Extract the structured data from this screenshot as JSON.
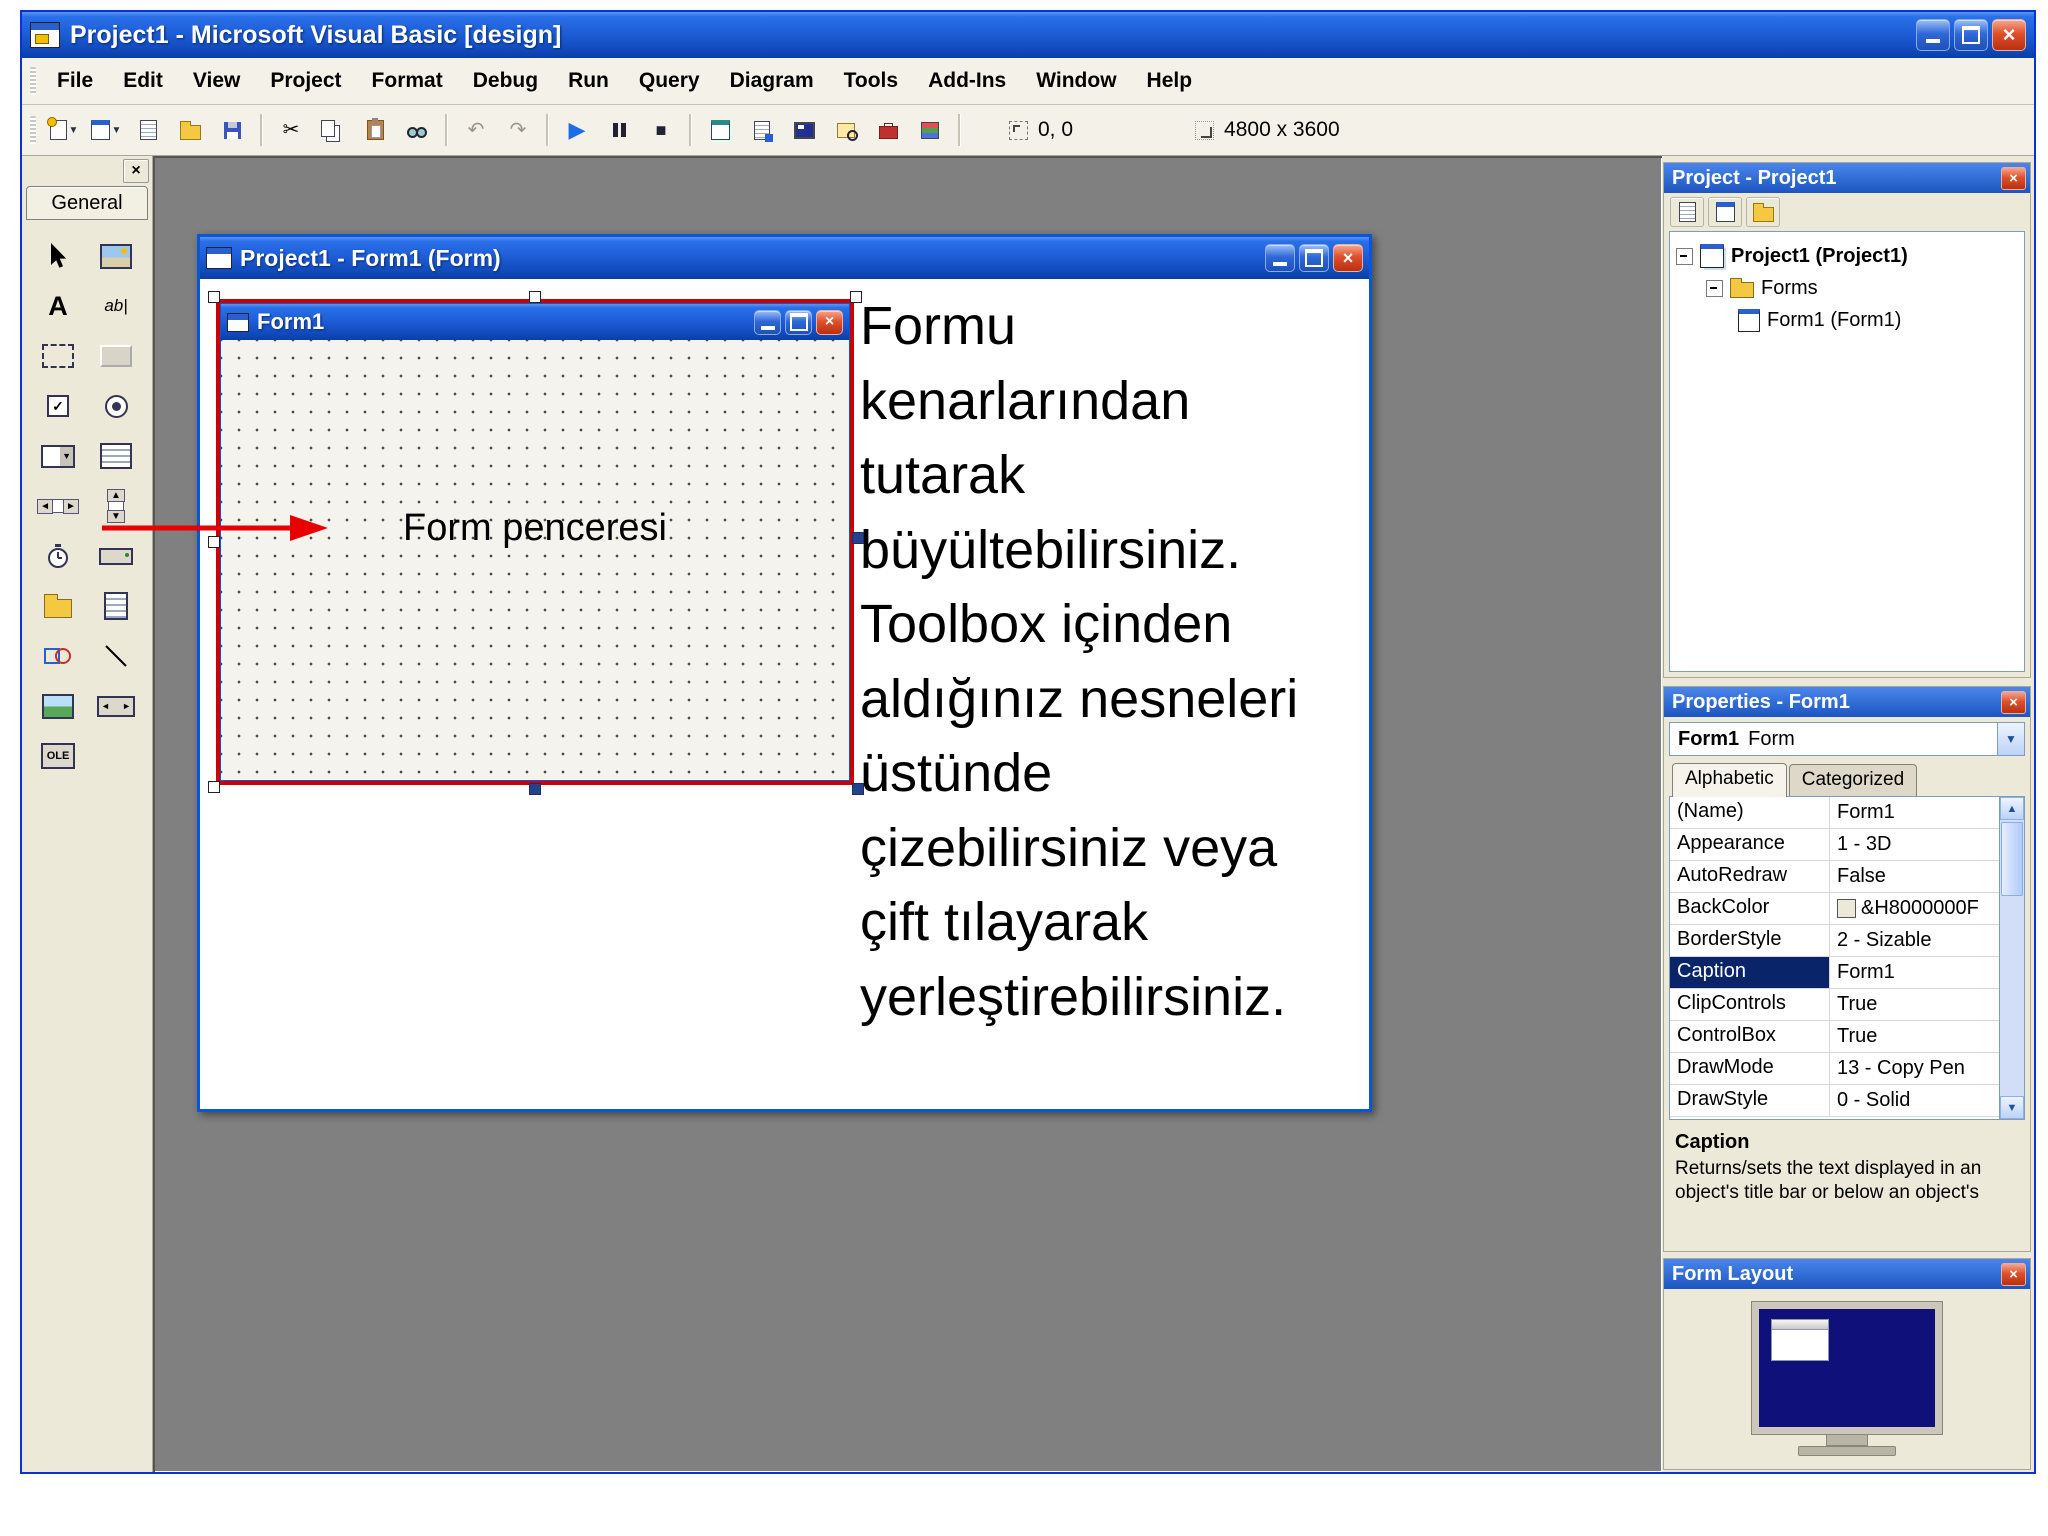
{
  "colors": {
    "titlebar_blue": "#1e5ed8",
    "mdi_background": "#808080",
    "selection_navy": "#0a246a",
    "annotation_red": "#e80000",
    "panel_face": "#ECE9D8"
  },
  "icons": {
    "close": "×",
    "dropdown": "▼",
    "up": "▲",
    "down": "▼",
    "left": "◄",
    "right": "►",
    "check": "✓",
    "cut": "✂",
    "undo": "↶",
    "redo": "↷",
    "start": "▶",
    "end": "■"
  },
  "titlebar": {
    "title": "Project1 - Microsoft Visual Basic [design]"
  },
  "menu": {
    "items": [
      "File",
      "Edit",
      "View",
      "Project",
      "Format",
      "Debug",
      "Run",
      "Query",
      "Diagram",
      "Tools",
      "Add-Ins",
      "Window",
      "Help"
    ]
  },
  "toolbar": {
    "position": "0, 0",
    "size": "4800 x 3600"
  },
  "toolbox": {
    "tab": "General",
    "glyphs": {
      "label": "A",
      "textbox": "ab|",
      "ole": "OLE"
    }
  },
  "mdi": {
    "child": {
      "title": "Project1 - Form1 (Form)",
      "form": {
        "title": "Form1",
        "label": "Form penceresi"
      },
      "note_lines": [
        "Formu",
        "kenarlarından",
        "tutarak",
        "büyültebilirsiniz.",
        "Toolbox içinden",
        "aldığınız nesneleri",
        "üstünde",
        "çizebilirsiniz veya",
        "çift tılayarak",
        "yerleştirebilirsiniz."
      ]
    }
  },
  "project_explorer": {
    "title": "Project - Project1",
    "tree": {
      "root": "Project1 (Project1)",
      "folder": "Forms",
      "item": "Form1 (Form1)"
    }
  },
  "properties": {
    "title": "Properties - Form1",
    "object_name": "Form1",
    "object_type": "Form",
    "tabs": [
      "Alphabetic",
      "Categorized"
    ],
    "rows": [
      {
        "name": "(Name)",
        "value": "Form1"
      },
      {
        "name": "Appearance",
        "value": "1 - 3D"
      },
      {
        "name": "AutoRedraw",
        "value": "False"
      },
      {
        "name": "BackColor",
        "value": "&H8000000F"
      },
      {
        "name": "BorderStyle",
        "value": "2 - Sizable"
      },
      {
        "name": "Caption",
        "value": "Form1"
      },
      {
        "name": "ClipControls",
        "value": "True"
      },
      {
        "name": "ControlBox",
        "value": "True"
      },
      {
        "name": "DrawMode",
        "value": "13 - Copy Pen"
      },
      {
        "name": "DrawStyle",
        "value": "0 - Solid"
      }
    ],
    "description": {
      "title": "Caption",
      "text": "Returns/sets the text displayed in an object's title bar or below an object's"
    }
  },
  "form_layout": {
    "title": "Form Layout"
  }
}
